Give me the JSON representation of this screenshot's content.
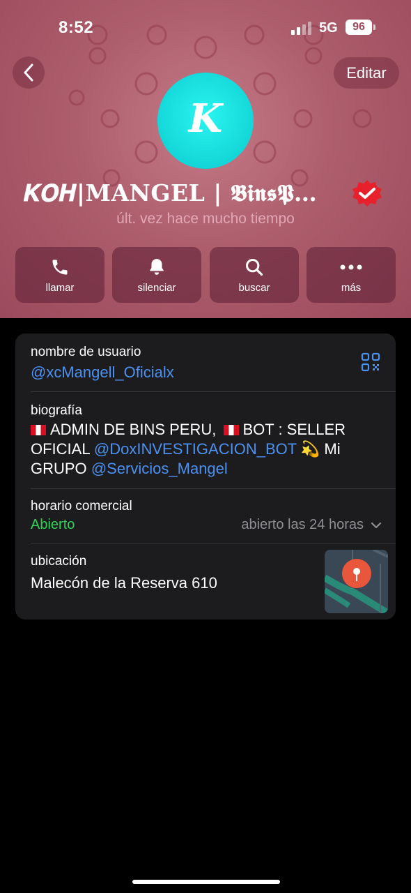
{
  "status_bar": {
    "time": "8:52",
    "network": "5G",
    "battery": "96"
  },
  "header": {
    "back_icon": "chevron-left-icon",
    "edit_label": "Editar",
    "avatar_letter": "K",
    "name": "𝑲𝑶𝑯|MANGEL | 𝕭𝖎𝖓𝖘𝕻…",
    "last_seen": "últ. vez hace mucho tiempo",
    "accent_color": "#ad5e6c"
  },
  "actions": [
    {
      "label": "llamar",
      "icon": "phone-icon"
    },
    {
      "label": "silenciar",
      "icon": "bell-icon"
    },
    {
      "label": "buscar",
      "icon": "search-icon"
    },
    {
      "label": "más",
      "icon": "more-icon"
    }
  ],
  "info": {
    "username": {
      "label": "nombre de usuario",
      "value": "@xcMangell_Oficialx"
    },
    "bio": {
      "label": "biografía",
      "part1": "ADMIN DE BINS PERU,",
      "part2": "BOT : SELLER OFICIAL",
      "mention1": "@DoxINVESTIGACION_BOT",
      "part3": "💫 Mi GRUPO",
      "mention2": "@Servicios_Mangel"
    },
    "hours": {
      "label": "horario comercial",
      "status": "Abierto",
      "detail": "abierto las 24 horas"
    },
    "location": {
      "label": "ubicación",
      "value": "Malecón de la Reserva 610"
    },
    "link_color": "#4b91f1",
    "open_color": "#30d158"
  }
}
